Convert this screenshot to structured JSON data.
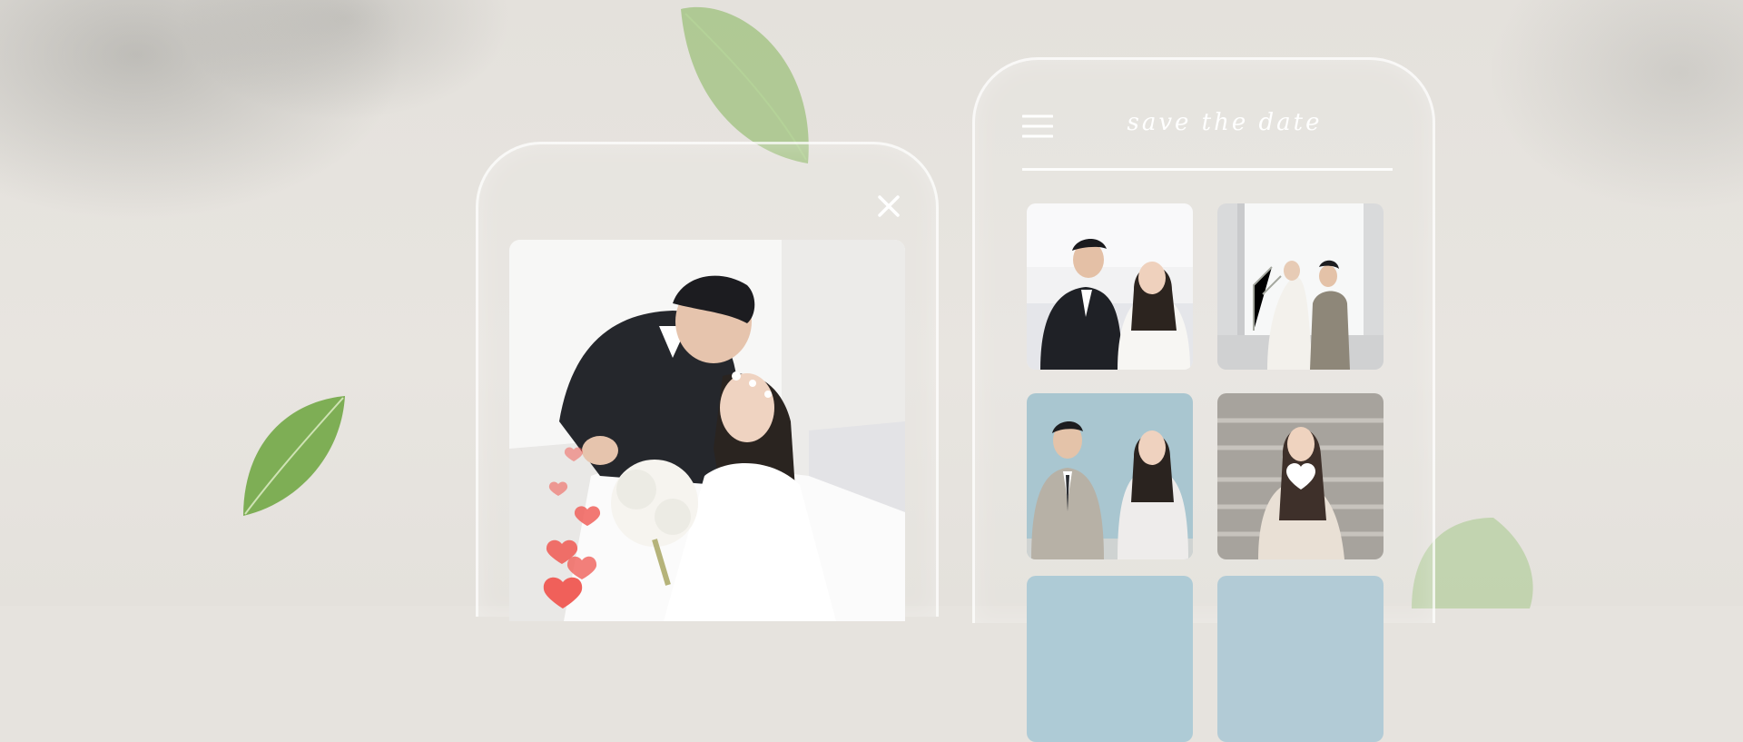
{
  "header": {
    "title": "save the date",
    "menu_icon": "hamburger-menu-icon"
  },
  "viewer": {
    "close_icon": "close-icon",
    "photo": "couple-embrace-photo",
    "hearts_icon": "heart-icon"
  },
  "gallery": {
    "liked_icon": "heart-icon",
    "photos": [
      "couple-sofa-photo",
      "couple-window-photo",
      "couple-blue-wall-photo",
      "bride-stairs-photo",
      "couple-photo-5",
      "couple-photo-6"
    ]
  },
  "colors": {
    "background": "#e6e3de",
    "frame": "#ffffff",
    "heart": "#f0605a",
    "leaf": "#8cb56a"
  }
}
